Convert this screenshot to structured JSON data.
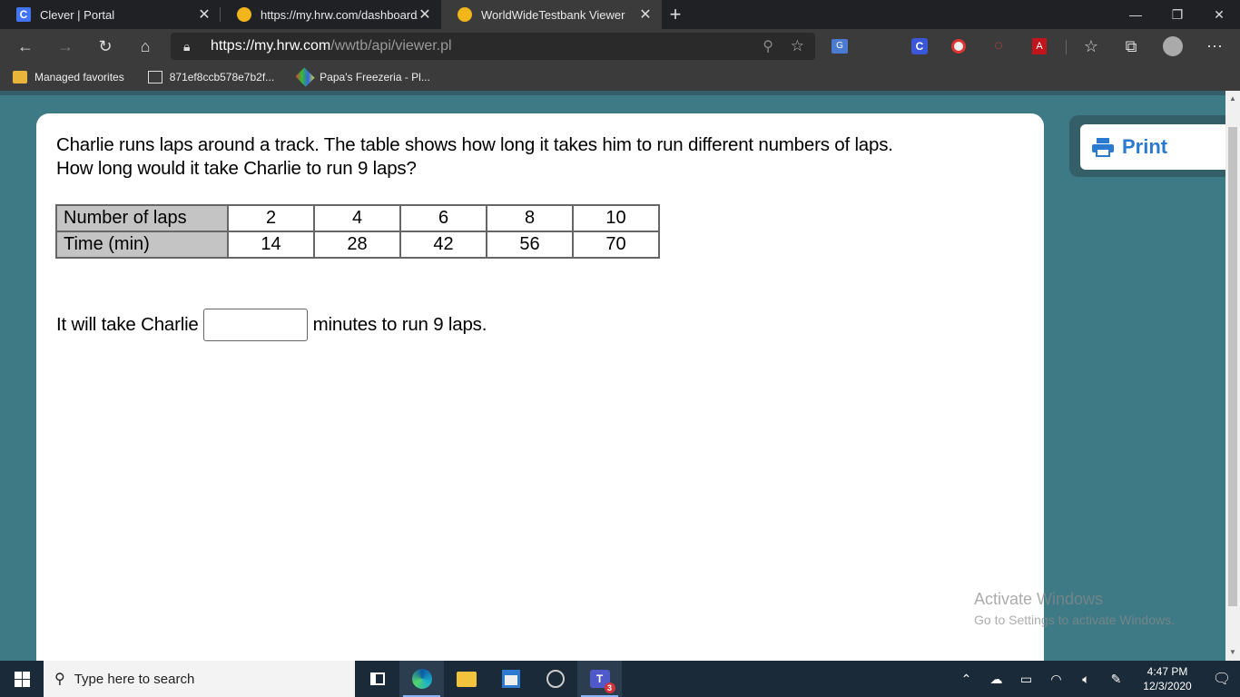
{
  "browser": {
    "tabs": [
      {
        "title": "Clever | Portal",
        "favicon_text": "C"
      },
      {
        "title": "https://my.hrw.com/dashboard/l"
      },
      {
        "title": "WorldWideTestbank Viewer"
      }
    ],
    "window_controls": {
      "minimize": "—",
      "restore": "❐",
      "close": "✕"
    },
    "address": {
      "host": "https://my.hrw.com",
      "path": "/wwtb/api/viewer.pl"
    },
    "favorites": [
      {
        "label": "Managed favorites",
        "icon": "folder-icon"
      },
      {
        "label": "871ef8ccb578e7b2f...",
        "icon": "page-icon"
      },
      {
        "label": "Papa's Freezeria - Pl...",
        "icon": "papa-icon"
      }
    ]
  },
  "content": {
    "question_line1": "Charlie runs laps around a track. The table shows how long it takes him to run different numbers of laps.",
    "question_line2": "How long would it take Charlie to run 9 laps?",
    "table": {
      "row_headers": [
        "Number of laps",
        "Time (min)"
      ],
      "laps": [
        "2",
        "4",
        "6",
        "8",
        "10"
      ],
      "times": [
        "14",
        "28",
        "42",
        "56",
        "70"
      ]
    },
    "answer": {
      "before": "It will take Charlie",
      "value": "",
      "after": "minutes to run 9 laps."
    },
    "print_label": "Print",
    "print_color": "#2a7bd0"
  },
  "watermark": {
    "line1": "Activate Windows",
    "line2": "Go to Settings to activate Windows."
  },
  "taskbar": {
    "search_placeholder": "Type here to search",
    "teams_badge": "3",
    "time": "4:47 PM",
    "date": "12/3/2020"
  }
}
